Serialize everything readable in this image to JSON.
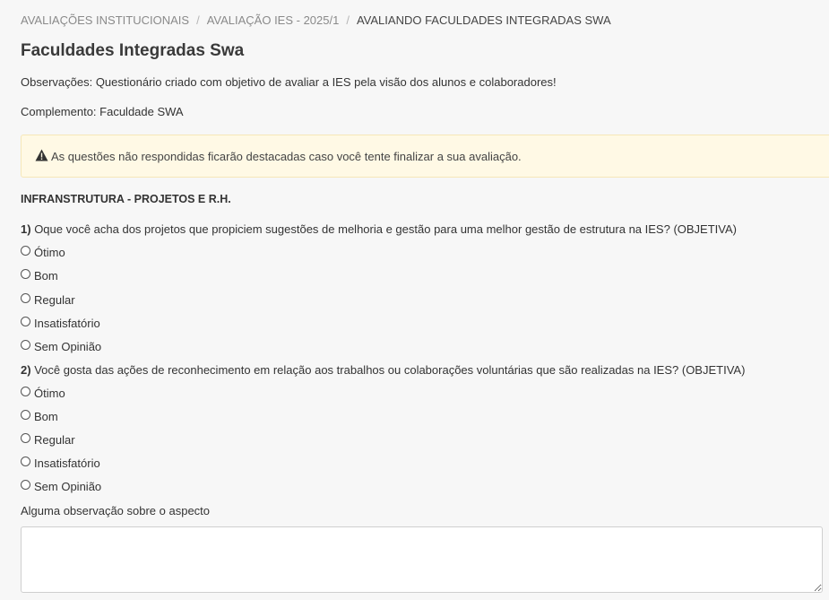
{
  "breadcrumb": {
    "item1": "AVALIAÇÕES INSTITUCIONAIS",
    "item2": "AVALIAÇÃO IES - 2025/1",
    "current": "AVALIANDO FACULDADES INTEGRADAS SWA",
    "separator": "/"
  },
  "page": {
    "title": "Faculdades Integradas Swa",
    "observacoes": "Observações: Questionário criado com objetivo de avaliar a IES pela visão dos alunos e colaboradores!",
    "complemento": "Complemento: Faculdade SWA"
  },
  "alert": {
    "icon": "warning-triangle",
    "text": "As questões não respondidas ficarão destacadas caso você tente finalizar a sua avaliação.",
    "background": "#fff9e5"
  },
  "section": {
    "title": "INFRANSTRUTURA - PROJETOS E R.H."
  },
  "questions": [
    {
      "number": "1)",
      "text": "Oque você acha dos projetos que propiciem sugestões de melhoria e gestão para uma melhor gestão de estrutura na IES? (OBJETIVA)",
      "options": [
        "Ótimo",
        "Bom",
        "Regular",
        "Insatisfatório",
        "Sem Opinião"
      ]
    },
    {
      "number": "2)",
      "text": "Você gosta das ações de reconhecimento em relação aos trabalhos ou colaborações voluntárias que são realizadas na IES? (OBJETIVA)",
      "options": [
        "Ótimo",
        "Bom",
        "Regular",
        "Insatisfatório",
        "Sem Opinião"
      ]
    }
  ],
  "observation": {
    "label": "Alguma observação sobre o aspecto",
    "value": ""
  }
}
